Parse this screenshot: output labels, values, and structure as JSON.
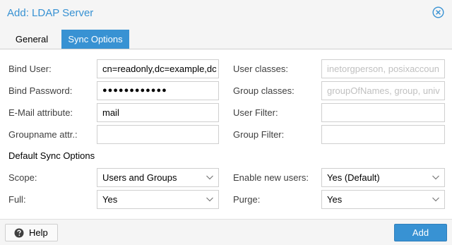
{
  "window": {
    "title": "Add: LDAP Server"
  },
  "tabs": {
    "general": "General",
    "sync": "Sync Options"
  },
  "left": {
    "bind_user": {
      "label": "Bind User:",
      "value": "cn=readonly,dc=example,dc"
    },
    "bind_password": {
      "label": "Bind Password:",
      "value": "●●●●●●●●●●●●"
    },
    "email_attr": {
      "label": "E-Mail attribute:",
      "value": "mail"
    },
    "groupname_attr": {
      "label": "Groupname attr.:",
      "value": ""
    }
  },
  "right": {
    "user_classes": {
      "label": "User classes:",
      "placeholder": "inetorgperson, posixaccoun"
    },
    "group_classes": {
      "label": "Group classes:",
      "placeholder": "groupOfNames, group, univ"
    },
    "user_filter": {
      "label": "User Filter:",
      "value": ""
    },
    "group_filter": {
      "label": "Group Filter:",
      "value": ""
    }
  },
  "defaults": {
    "heading": "Default Sync Options",
    "scope": {
      "label": "Scope:",
      "value": "Users and Groups"
    },
    "full": {
      "label": "Full:",
      "value": "Yes"
    },
    "enable_new_users": {
      "label": "Enable new users:",
      "value": "Yes (Default)"
    },
    "purge": {
      "label": "Purge:",
      "value": "Yes"
    }
  },
  "footer": {
    "help_label": "Help",
    "add_label": "Add"
  },
  "colors": {
    "accent": "#3892d3",
    "placeholder": "#c0c0c0"
  }
}
